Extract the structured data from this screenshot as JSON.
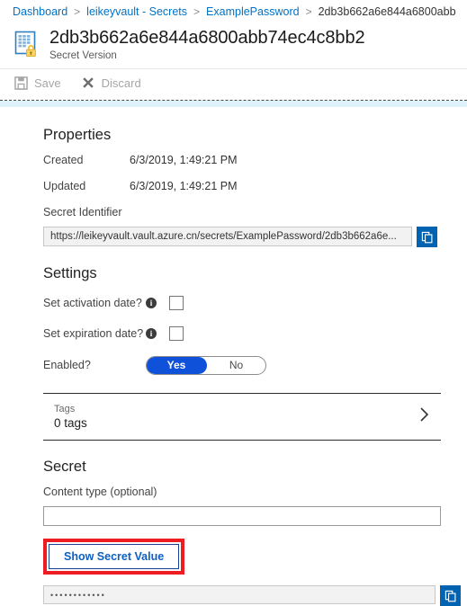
{
  "breadcrumb": {
    "items": [
      {
        "label": "Dashboard",
        "current": false
      },
      {
        "label": "leikeyvault - Secrets",
        "current": false
      },
      {
        "label": "ExamplePassword",
        "current": false
      },
      {
        "label": "2db3b662a6e844a6800abb",
        "current": true
      }
    ],
    "separator": ">"
  },
  "header": {
    "title": "2db3b662a6e844a6800abb74ec4c8bb2",
    "subtitle": "Secret Version",
    "icon": "secret-version-icon"
  },
  "toolbar": {
    "save_label": "Save",
    "save_icon": "save-disk-icon",
    "discard_label": "Discard",
    "discard_icon": "close-x-icon"
  },
  "properties": {
    "heading": "Properties",
    "created_label": "Created",
    "created_value": "6/3/2019, 1:49:21 PM",
    "updated_label": "Updated",
    "updated_value": "6/3/2019, 1:49:21 PM",
    "identifier_label": "Secret Identifier",
    "identifier_value": "https://leikeyvault.vault.azure.cn/secrets/ExamplePassword/2db3b662a6e...",
    "copy_icon": "copy-icon"
  },
  "settings": {
    "heading": "Settings",
    "activation_label": "Set activation date?",
    "activation_checked": false,
    "expiration_label": "Set expiration date?",
    "expiration_checked": false,
    "enabled_label": "Enabled?",
    "enabled_yes": "Yes",
    "enabled_no": "No",
    "enabled_selected": "Yes",
    "info_glyph": "i"
  },
  "tags": {
    "label": "Tags",
    "value": "0 tags",
    "chevron_icon": "chevron-right-icon"
  },
  "secret": {
    "heading": "Secret",
    "content_type_label": "Content type (optional)",
    "content_type_value": "",
    "content_type_placeholder": "",
    "show_button_label": "Show Secret Value",
    "masked_value": "••••••••••••",
    "copy_icon": "copy-icon"
  },
  "colors": {
    "link_blue": "#0072c6",
    "accent_blue": "#0063b1",
    "toggle_blue": "#0f51d8",
    "annotation_red": "#ee1d24",
    "button_text_blue": "#0f5fbf",
    "band_cyan": "#ddf2fb"
  }
}
